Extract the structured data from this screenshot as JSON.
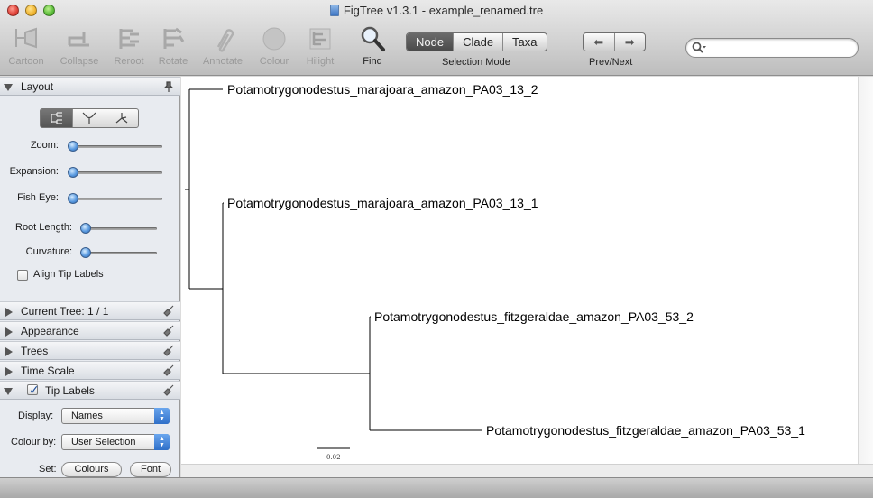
{
  "window": {
    "title": "FigTree v1.3.1 - example_renamed.tre"
  },
  "toolbar": {
    "tools": [
      {
        "label": "Cartoon",
        "icon": "cartoon-icon",
        "enabled": false
      },
      {
        "label": "Collapse",
        "icon": "collapse-icon",
        "enabled": false
      },
      {
        "label": "Reroot",
        "icon": "reroot-icon",
        "enabled": false
      },
      {
        "label": "Rotate",
        "icon": "rotate-icon",
        "enabled": false
      },
      {
        "label": "Annotate",
        "icon": "paperclip-icon",
        "enabled": false
      },
      {
        "label": "Colour",
        "icon": "colour-circle-icon",
        "enabled": false
      },
      {
        "label": "Hilight",
        "icon": "hilight-icon",
        "enabled": false
      }
    ],
    "find_label": "Find",
    "selection_mode": {
      "caption": "Selection Mode",
      "options": [
        "Node",
        "Clade",
        "Taxa"
      ],
      "selected": "Node"
    },
    "prev_next_label": "Prev/Next",
    "search_placeholder": ""
  },
  "sidebar": {
    "layout_panel": {
      "title": "Layout",
      "expanded": true,
      "sliders": [
        {
          "label": "Zoom:",
          "value": 0
        },
        {
          "label": "Expansion:",
          "value": 0
        },
        {
          "label": "Fish Eye:",
          "value": 0
        },
        {
          "label": "Root Length:",
          "value": 0
        },
        {
          "label": "Curvature:",
          "value": 0
        }
      ],
      "align_tip_labels": {
        "label": "Align Tip Labels",
        "checked": false
      }
    },
    "current_tree": {
      "label": "Current Tree: 1 / 1"
    },
    "appearance": {
      "label": "Appearance"
    },
    "trees": {
      "label": "Trees"
    },
    "time_scale": {
      "label": "Time Scale"
    },
    "tip_labels": {
      "label": "Tip Labels",
      "checked": true,
      "display_label": "Display:",
      "display_value": "Names",
      "colour_by_label": "Colour by:",
      "colour_by_value": "User Selection",
      "set_label": "Set:",
      "colours_button": "Colours",
      "font_button": "Font"
    }
  },
  "tree": {
    "tips": [
      "Potamotrygonodestus_marajoara_amazon_PA03_13_2",
      "Potamotrygonodestus_marajoara_amazon_PA03_13_1",
      "Potamotrygonodestus_fitzgeraldae_amazon_PA03_53_2",
      "Potamotrygonodestus_fitzgeraldae_amazon_PA03_53_1"
    ],
    "scale_bar_label": "0.02",
    "branch_color": "#000000"
  },
  "colors": {
    "selected_segment": "#555555",
    "slider_knob": "#5b9be0",
    "popup_arrows": "#2f6fc8"
  }
}
